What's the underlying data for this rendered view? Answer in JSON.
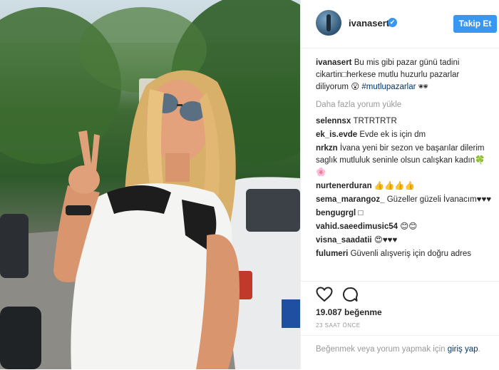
{
  "post": {
    "username": "ivanasert",
    "follow_label": "Takip Et",
    "verified_icon": "✔",
    "caption_text": "Bu mis gibi pazar günü tadini cikartin□herkese mutlu huzurlu pazarlar diliyorum 😮 ",
    "hashtag": "#mutlupazarlar",
    "caption_emoji": "🕶",
    "load_more": "Daha fazla yorum yükle",
    "likes": "19.087 beğenme",
    "time_ago": "23 SAAT ÖNCE"
  },
  "comments": [
    {
      "user": "selennsx",
      "text": "ТRТRТRТR"
    },
    {
      "user": "ek_is.evde",
      "text": "Evde ek is için dm"
    },
    {
      "user": "nrkzn",
      "text": "İvana yeni bir sezon ve başarılar dilerim saglık mutluluk seninle olsun calışkan kadın🍀🌸"
    },
    {
      "user": "nurtenerduran",
      "text": "👍👍👍👍"
    },
    {
      "user": "sema_marangoz_",
      "text": "Güzeller güzeli İvanacım♥♥♥"
    },
    {
      "user": "bengugrgl",
      "text": "□"
    },
    {
      "user": "vahid.saeedimusic54",
      "text": "😊😊"
    },
    {
      "user": "visna_saadatii",
      "text": "😍♥♥♥"
    },
    {
      "user": "fulumeri",
      "text": "Güvenli alışveriş için doğru adres"
    }
  ],
  "footer": {
    "prompt_text": "Beğenmek veya yorum yapmak için ",
    "login_text": "giriş yap",
    "prompt_end": "."
  },
  "icons": {
    "like": "heart-icon",
    "comment": "comment-icon"
  },
  "colors": {
    "accent": "#3897f0",
    "link": "#003569",
    "muted": "#999999"
  }
}
